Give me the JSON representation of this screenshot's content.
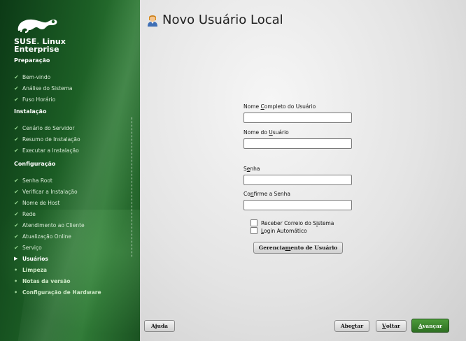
{
  "sidebar": {
    "brand_line1": "SUSE",
    "brand_sep": ".",
    "brand_line1b": " Linux",
    "brand_line2": "Enterprise",
    "sections": [
      {
        "label": "Preparação"
      },
      {
        "label": "Instalação"
      },
      {
        "label": "Configuração"
      }
    ],
    "items": [
      {
        "label": "Bem-vindo",
        "state": "done"
      },
      {
        "label": "Análise do Sistema",
        "state": "done"
      },
      {
        "label": "Fuso Horário",
        "state": "done"
      },
      {
        "label": "Cenário do Servidor",
        "state": "done"
      },
      {
        "label": "Resumo de Instalação",
        "state": "done"
      },
      {
        "label": "Executar a Instalação",
        "state": "done"
      },
      {
        "label": "Senha Root",
        "state": "done"
      },
      {
        "label": "Verificar a Instalação",
        "state": "done"
      },
      {
        "label": "Nome de Host",
        "state": "done"
      },
      {
        "label": "Rede",
        "state": "done"
      },
      {
        "label": "Atendimento ao Cliente",
        "state": "done"
      },
      {
        "label": "Atualização Online",
        "state": "done"
      },
      {
        "label": "Serviço",
        "state": "done"
      },
      {
        "label": "Usuários",
        "state": "current"
      },
      {
        "label": "Limpeza",
        "state": "pending"
      },
      {
        "label": "Notas da versão",
        "state": "pending"
      },
      {
        "label": "Configuração de Hardware",
        "state": "pending"
      }
    ]
  },
  "main": {
    "title": "Novo Usuário Local",
    "fields": {
      "full_name": {
        "label_pre": "Nome ",
        "label_u": "C",
        "label_post": "ompleto do Usuário",
        "value": ""
      },
      "username": {
        "label_pre": "Nome do ",
        "label_u": "U",
        "label_post": "suário",
        "value": ""
      },
      "password": {
        "label_pre": "S",
        "label_u": "e",
        "label_post": "nha",
        "value": ""
      },
      "confirm": {
        "label_pre": "Co",
        "label_u": "n",
        "label_post": "firme a Senha",
        "value": ""
      }
    },
    "checkboxes": {
      "mail": {
        "label_pre": "Receber Correio do S",
        "label_u": "i",
        "label_post": "stema",
        "checked": false
      },
      "autologin": {
        "label_pre": "",
        "label_u": "L",
        "label_post": "ogin Automático",
        "checked": false
      }
    },
    "manage_button": {
      "pre": "Gerencia",
      "u": "m",
      "post": "ento de Usuário"
    }
  },
  "footer": {
    "help": "Ajuda",
    "abort_pre": "Abo",
    "abort_u": "r",
    "abort_post": "tar",
    "back_pre": "",
    "back_u": "V",
    "back_post": "oltar",
    "next_pre": "",
    "next_u": "A",
    "next_post": "vançar"
  },
  "colors": {
    "sidebar_green": "#1c5e25",
    "primary_button": "#2d6f22"
  },
  "icons": {
    "logo": "suse-chameleon-logo",
    "title": "user-icon",
    "done": "checkmark-icon",
    "current": "arrow-right-icon",
    "pending": "bullet-icon"
  }
}
